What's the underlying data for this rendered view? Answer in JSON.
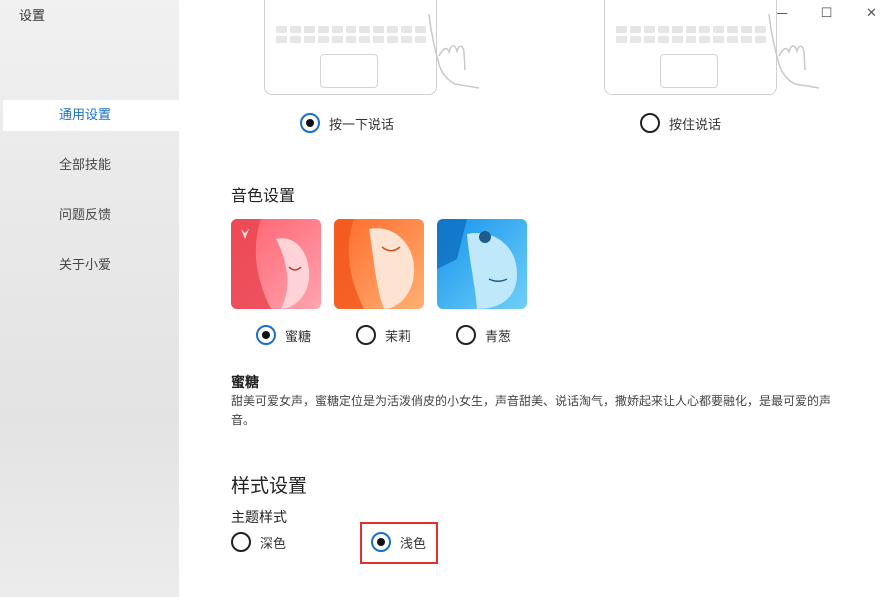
{
  "app": {
    "title": "设置"
  },
  "window_controls": {
    "minimize": "—",
    "maximize": "☐",
    "close": "✕"
  },
  "sidebar": {
    "items": [
      {
        "label": "通用设置",
        "active": true
      },
      {
        "label": "全部技能",
        "active": false
      },
      {
        "label": "问题反馈",
        "active": false
      },
      {
        "label": "关于小爱",
        "active": false
      }
    ]
  },
  "wake_mode": {
    "options": [
      {
        "label": "按一下说话",
        "selected": true
      },
      {
        "label": "按住说话",
        "selected": false
      }
    ]
  },
  "voice": {
    "section_title": "音色设置",
    "options": [
      {
        "label": "蜜糖",
        "selected": true,
        "colors": [
          "#ff6f7a",
          "#ff9aa6"
        ]
      },
      {
        "label": "茉莉",
        "selected": false,
        "colors": [
          "#ff7a3d",
          "#ffa05c"
        ]
      },
      {
        "label": "青葱",
        "selected": false,
        "colors": [
          "#1e9ff0",
          "#5fc6f5"
        ]
      }
    ],
    "selected_name": "蜜糖",
    "selected_description": "甜美可爱女声，蜜糖定位是为活泼俏皮的小女生，声音甜美、说话淘气，撒娇起来让人心都要融化，是最可爱的声音。"
  },
  "style": {
    "section_title": "样式设置",
    "theme_label": "主题样式",
    "options": [
      {
        "label": "深色",
        "selected": false
      },
      {
        "label": "浅色",
        "selected": true
      }
    ]
  }
}
